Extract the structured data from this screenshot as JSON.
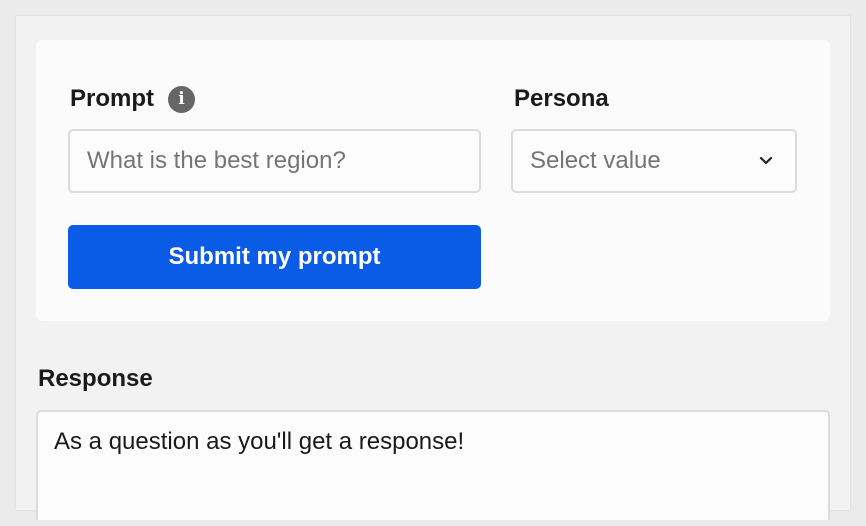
{
  "form": {
    "prompt_label": "Prompt",
    "prompt_info_icon": "info-icon",
    "prompt_placeholder": "What is the best region?",
    "prompt_value": "",
    "persona_label": "Persona",
    "persona_selected": "Select value",
    "persona_icon": "chevron-down-icon",
    "submit_label": "Submit my prompt"
  },
  "response": {
    "label": "Response",
    "text": "As a question as you'll get a response!"
  },
  "colors": {
    "accent": "#0a5ce6",
    "background": "#ebebeb",
    "card": "#fbfbfb",
    "border": "#dcdcdc",
    "info_icon": "#666666"
  }
}
